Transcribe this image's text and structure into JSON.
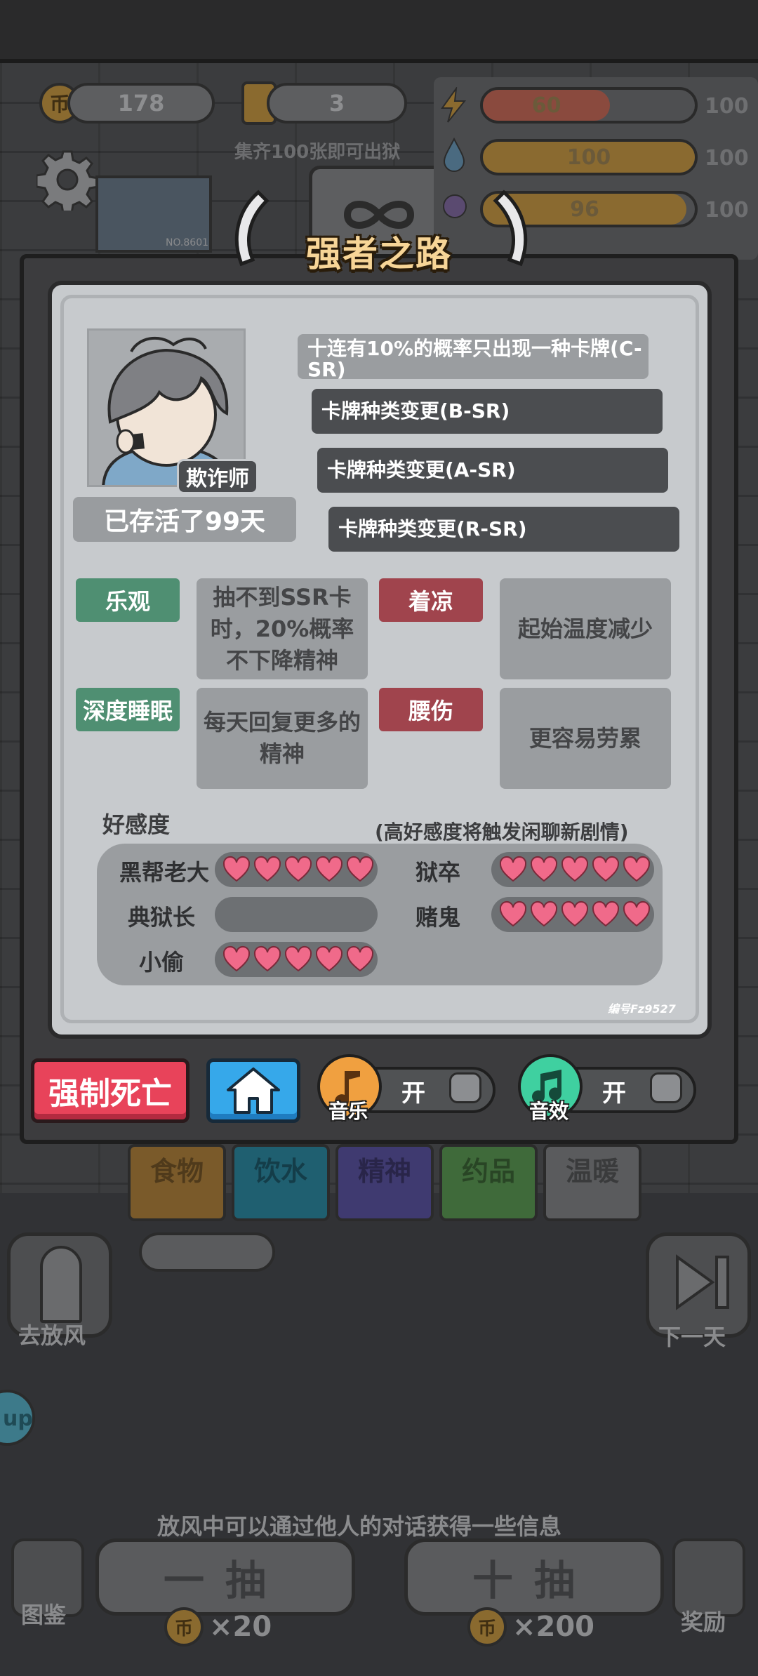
{
  "hud": {
    "coins": "178",
    "tickets": "3",
    "collect_hint": "集齐100张即可出狱",
    "stats": [
      {
        "icon": "energy-icon",
        "value": "60",
        "max": "100",
        "fill": 0.6,
        "color": "#8a4a3e"
      },
      {
        "icon": "water-icon",
        "value": "100",
        "max": "100",
        "fill": 1.0,
        "color": "#8a6a30"
      },
      {
        "icon": "food-icon",
        "value": "96",
        "max": "100",
        "fill": 0.96,
        "color": "#8a6a30"
      }
    ]
  },
  "dialog": {
    "title": "强者之路",
    "role": "欺诈师",
    "days_survived": "已存活了99天",
    "abilities": [
      "十连有10%的概率只出现一种卡牌(C-SR)",
      "卡牌种类变更(B-SR)",
      "卡牌种类变更(A-SR)",
      "卡牌种类变更(R-SR)"
    ],
    "traits": [
      {
        "name": "乐观",
        "kind": "good",
        "desc": "抽不到SSR卡时，20%概率不下降精神"
      },
      {
        "name": "着凉",
        "kind": "bad",
        "desc": "起始温度减少"
      },
      {
        "name": "深度睡眠",
        "kind": "good",
        "desc": "每天回复更多的精神"
      },
      {
        "name": "腰伤",
        "kind": "bad",
        "desc": "更容易劳累"
      }
    ],
    "affinity_title": "好感度",
    "affinity_note": "(高好感度将触发闲聊新剧情)",
    "affinity": [
      {
        "name": "黑帮老大",
        "hearts": 5
      },
      {
        "name": "狱卒",
        "hearts": 5
      },
      {
        "name": "典狱长",
        "hearts": 0
      },
      {
        "name": "赌鬼",
        "hearts": 5
      },
      {
        "name": "小偷",
        "hearts": 5
      }
    ],
    "serial": "编号Fz9527"
  },
  "actions": {
    "force_death": "强制死亡",
    "music_label": "音乐",
    "music_state": "开",
    "sfx_label": "音效",
    "sfx_state": "开"
  },
  "background": {
    "tabs": [
      "食物",
      "饮水",
      "精神",
      "约品",
      "温暖"
    ],
    "go_yard": "去放风",
    "next_day": "下一天",
    "yard_tip": "放风中可以通过他人的对话获得一些信息",
    "draw_one": "一抽",
    "draw_ten": "十抽",
    "draw_one_price": "×20",
    "draw_ten_price": "×200",
    "codex": "图鉴",
    "reward": "奖励",
    "side_badge": "up",
    "prisoner_no": "NO.8601",
    "coin_glyph": "币"
  },
  "colors": {
    "good_trait": "#4f8f72",
    "bad_trait": "#a0444d",
    "heart": "#f06a8a",
    "force_death": "#e8435a",
    "home": "#36a8ea",
    "music": "#f0a040",
    "sfx": "#3fd0a0"
  }
}
